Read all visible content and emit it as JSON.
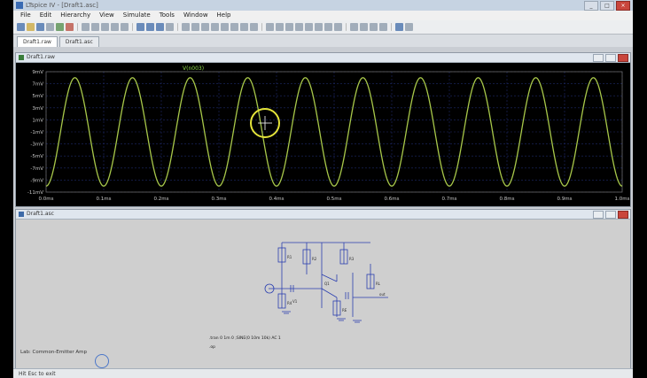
{
  "window": {
    "title": "LTspice IV - [Draft1.asc]"
  },
  "menu": [
    "File",
    "Edit",
    "Hierarchy",
    "View",
    "Simulate",
    "Tools",
    "Window",
    "Help"
  ],
  "tabs": [
    {
      "label": "Draft1.raw"
    },
    {
      "label": "Draft1.asc"
    }
  ],
  "waveform": {
    "pane_title": "Draft1.raw",
    "trace_label": "V(n003)",
    "cursor_label": "",
    "y_ticks": [
      "9mV",
      "7mV",
      "5mV",
      "3mV",
      "1mV",
      "-1mV",
      "-3mV",
      "-5mV",
      "-7mV",
      "-9mV",
      "-11mV"
    ],
    "x_ticks": [
      "0.0ms",
      "0.1ms",
      "0.2ms",
      "0.3ms",
      "0.4ms",
      "0.5ms",
      "0.6ms",
      "0.7ms",
      "0.8ms",
      "0.9ms",
      "1.0ms"
    ]
  },
  "chart_data": {
    "type": "line",
    "title": "",
    "xlabel": "",
    "ylabel": "",
    "x_unit": "ms",
    "y_unit": "mV",
    "xlim": [
      0,
      1.0
    ],
    "ylim": [
      -11,
      9
    ],
    "grid": true,
    "series": [
      {
        "name": "V(n003)",
        "shape": "sine",
        "amplitude": 9,
        "offset": -1,
        "cycles": 10,
        "color": "#a8c84a"
      }
    ]
  },
  "schematic": {
    "pane_title": "Draft1.asc",
    "note_line1": ".tran 0 1m 0 ;SINE(0 10m 10k) AC 1",
    "note_line2": ".op"
  },
  "left_text": "Lab: Common-Emitter Amp",
  "status": "Hit Esc to exit"
}
